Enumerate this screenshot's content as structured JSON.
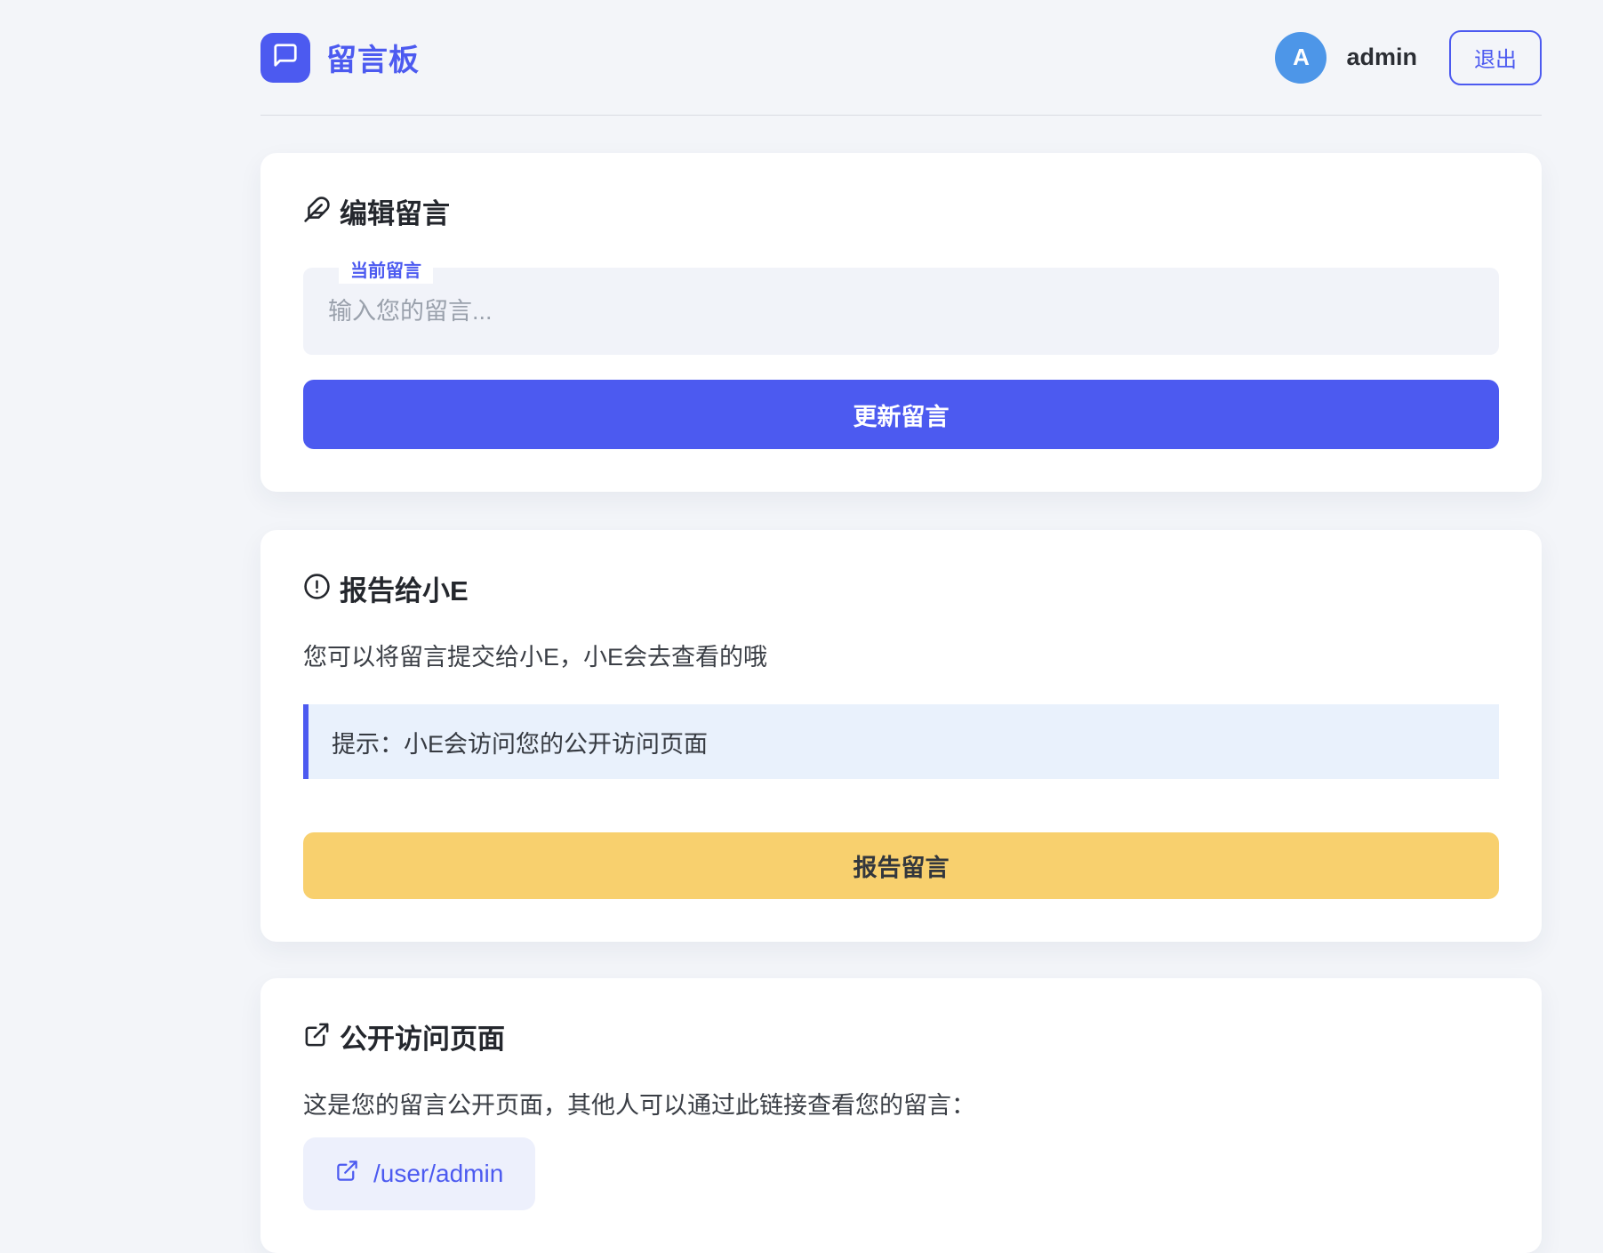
{
  "header": {
    "app_title": "留言板",
    "logo_icon": "message-square-icon",
    "user": {
      "avatar_initial": "A",
      "username": "admin"
    },
    "logout_label": "退出"
  },
  "edit_card": {
    "icon": "feather-icon",
    "title": "编辑留言",
    "field_label": "当前留言",
    "textarea_value": "",
    "textarea_placeholder": "输入您的留言...",
    "submit_label": "更新留言"
  },
  "report_card": {
    "icon": "alert-circle-icon",
    "title": "报告给小E",
    "description": "您可以将留言提交给小E，小E会去查看的哦",
    "tip": "提示：小E会访问您的公开访问页面",
    "submit_label": "报告留言"
  },
  "public_card": {
    "icon": "external-link-icon",
    "title": "公开访问页面",
    "description": "这是您的留言公开页面，其他人可以通过此链接查看您的留言：",
    "link_icon": "external-link-icon",
    "link_label": "/user/admin"
  },
  "colors": {
    "primary": "#4c5af0",
    "avatar_blue": "#4d96e8",
    "warning_yellow": "#f8d06e",
    "info_bg": "#e9f1fc",
    "page_bg": "#f3f5f9"
  }
}
